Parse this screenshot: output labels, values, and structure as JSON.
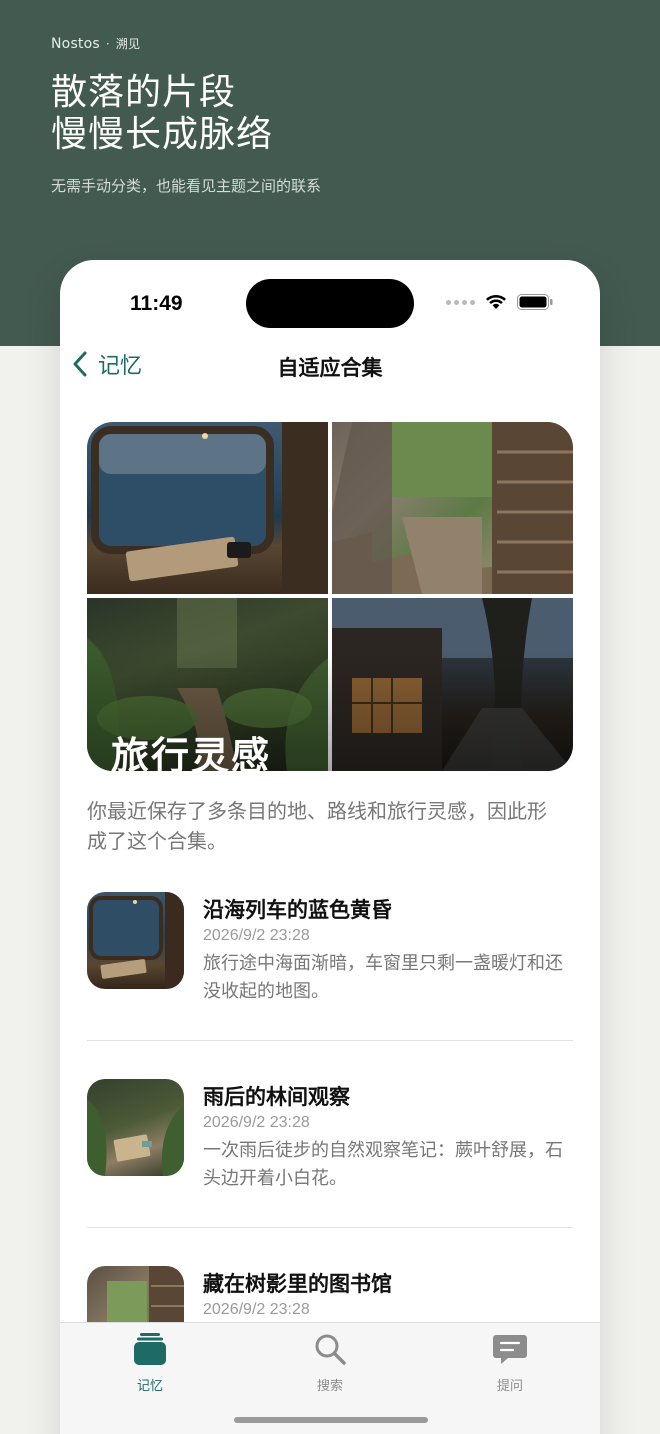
{
  "hero": {
    "brand": "Nostos",
    "separator": "·",
    "brand_cn": "溯见",
    "headline_line1": "散落的片段",
    "headline_line2": "慢慢长成脉络",
    "subline": "无需手动分类，也能看见主题之间的联系"
  },
  "status_bar": {
    "time": "11:49"
  },
  "nav": {
    "back_label": "记忆",
    "title": "自适应合集"
  },
  "collection": {
    "cover_title": "旅行灵感",
    "description": "你最近保存了多条目的地、路线和旅行灵感，因此形成了这个合集。"
  },
  "items": [
    {
      "title": "沿海列车的蓝色黄昏",
      "date": "2026/9/2 23:28",
      "body": "旅行途中海面渐暗，车窗里只剩一盏暖灯和还没收起的地图。"
    },
    {
      "title": "雨后的林间观察",
      "date": "2026/9/2 23:28",
      "body": "一次雨后徒步的自然观察笔记：蕨叶舒展，石头边开着小白花。"
    },
    {
      "title": "藏在树影里的图书馆",
      "date": "2026/9/2 23:28",
      "body": ""
    }
  ],
  "tabbar": {
    "tabs": [
      {
        "label": "记忆",
        "icon": "stack-icon",
        "active": true
      },
      {
        "label": "搜索",
        "icon": "search-icon",
        "active": false
      },
      {
        "label": "提问",
        "icon": "chat-bubble-icon",
        "active": false
      }
    ]
  },
  "colors": {
    "hero_bg": "#435a50",
    "accent": "#1e6b66",
    "page_bg": "#f1f1ee"
  }
}
